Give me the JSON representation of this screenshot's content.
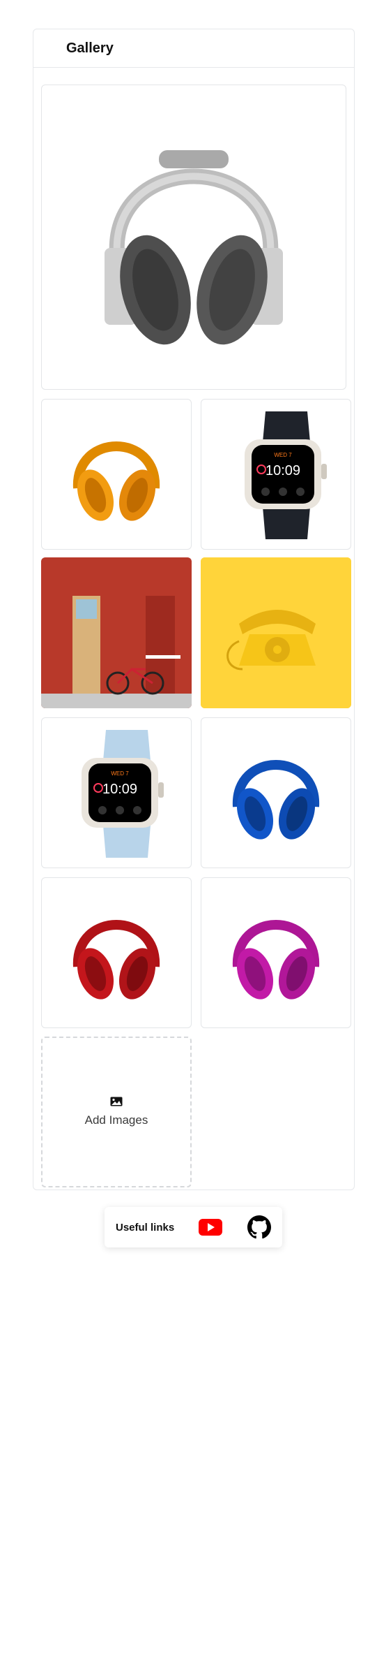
{
  "gallery": {
    "title": "Gallery",
    "images": [
      {
        "id": "featured",
        "alt": "Headphones (gray)",
        "icon": "headphones",
        "color": "#8a8a8a"
      },
      {
        "id": "img-1",
        "alt": "Headphones (orange)",
        "icon": "headphones",
        "color": "#f29c11"
      },
      {
        "id": "img-2",
        "alt": "Smartwatch (midnight)",
        "icon": "watch",
        "color": "#1f232b"
      },
      {
        "id": "img-3",
        "alt": "Red brick wall with bicycle",
        "icon": "photo"
      },
      {
        "id": "img-4",
        "alt": "Yellow rotary phone",
        "icon": "phone",
        "color": "#f6c518"
      },
      {
        "id": "img-5",
        "alt": "Smartwatch (light blue)",
        "icon": "watch",
        "color": "#b8d4ea"
      },
      {
        "id": "img-6",
        "alt": "Headphones (blue)",
        "icon": "headphones",
        "color": "#1156c9"
      },
      {
        "id": "img-7",
        "alt": "Headphones (red)",
        "icon": "headphones",
        "color": "#c4161c"
      },
      {
        "id": "img-8",
        "alt": "Headphones (magenta)",
        "icon": "headphones",
        "color": "#c21aa7"
      }
    ],
    "add_label": "Add Images",
    "add_icon": "image-icon"
  },
  "footer": {
    "useful_links_label": "Useful links",
    "links": [
      {
        "icon": "youtube-icon",
        "color": "#ff0000"
      },
      {
        "icon": "github-icon",
        "color": "#000000"
      }
    ]
  },
  "watch_time": "10:09",
  "watch_day": "WED 7"
}
